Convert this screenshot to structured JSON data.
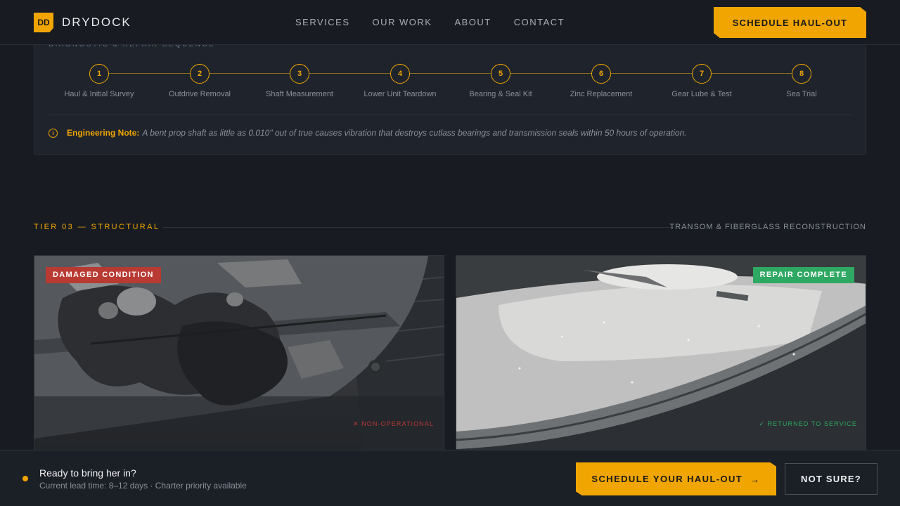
{
  "header": {
    "logo_mark": "DD",
    "brand": "DRYDOCK",
    "nav": [
      "SERVICES",
      "OUR WORK",
      "ABOUT",
      "CONTACT"
    ],
    "cta": "SCHEDULE HAUL-OUT"
  },
  "process": {
    "heading": "DIAGNOSTIC & REPAIR SEQUENCE",
    "steps": [
      {
        "num": "1",
        "label": "Haul & Initial Survey"
      },
      {
        "num": "2",
        "label": "Outdrive Removal"
      },
      {
        "num": "3",
        "label": "Shaft Measurement"
      },
      {
        "num": "4",
        "label": "Lower Unit Teardown"
      },
      {
        "num": "5",
        "label": "Bearing & Seal Kit"
      },
      {
        "num": "6",
        "label": "Zinc Replacement"
      },
      {
        "num": "7",
        "label": "Gear Lube & Test"
      },
      {
        "num": "8",
        "label": "Sea Trial"
      }
    ],
    "note_icon": "i",
    "note_label": "Engineering Note:",
    "note_text": "A bent prop shaft as little as 0.010\" out of true causes vibration that destroys cutlass bearings and transmission seals within 50 hours of operation."
  },
  "tier": {
    "label": "TIER 03 — STRUCTURAL",
    "subtitle": "TRANSOM & FIBERGLASS RECONSTRUCTION"
  },
  "before": {
    "badge": "DAMAGED CONDITION",
    "footer": "✕ NON-OPERATIONAL"
  },
  "after": {
    "badge": "REPAIR COMPLETE",
    "footer": "✓ RETURNED TO SERVICE"
  },
  "cta_bar": {
    "title": "Ready to bring her in?",
    "subtitle": "Current lead time: 8–12 days · Charter priority available",
    "primary": "SCHEDULE YOUR HAUL-OUT",
    "primary_arrow": "→",
    "secondary": "NOT SURE?"
  },
  "colors": {
    "accent": "#f0a500",
    "background": "#181c22",
    "danger": "#b83a32",
    "success": "#2ea862"
  }
}
